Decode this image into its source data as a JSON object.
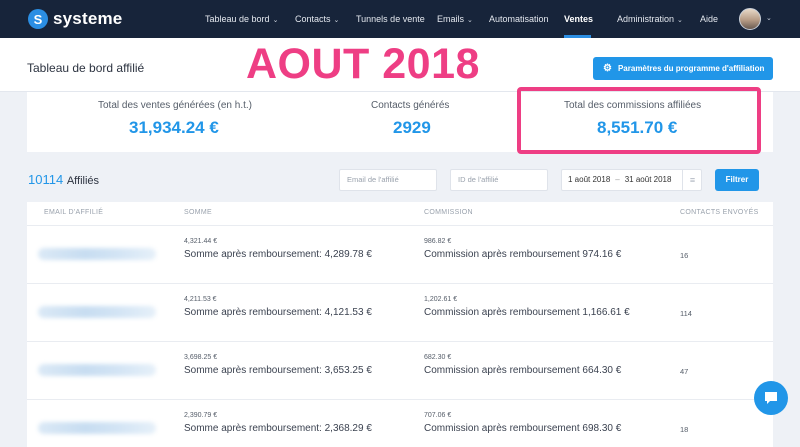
{
  "app": {
    "logo_text": "systeme",
    "logo_glyph": "S"
  },
  "nav": {
    "items": [
      {
        "label": "Tableau de bord",
        "has_dropdown": true
      },
      {
        "label": "Contacts",
        "has_dropdown": true
      },
      {
        "label": "Tunnels de vente",
        "has_dropdown": false
      },
      {
        "label": "Emails",
        "has_dropdown": true
      },
      {
        "label": "Automatisation",
        "has_dropdown": false
      },
      {
        "label": "Ventes",
        "has_dropdown": false,
        "active": true
      },
      {
        "label": "Administration",
        "has_dropdown": true
      },
      {
        "label": "Aide",
        "has_dropdown": false
      }
    ],
    "chevron_glyph": "⌄"
  },
  "header": {
    "title": "Tableau de bord affilié",
    "overlay": "AOUT 2018",
    "settings_button": "Paramètres du programme d'affiliation"
  },
  "stats": [
    {
      "label": "Total des ventes générées (en h.t.)",
      "value": "31,934.24 €"
    },
    {
      "label": "Contacts générés",
      "value": "2929"
    },
    {
      "label": "Total des commissions affiliées",
      "value": "8,551.70 €"
    }
  ],
  "filters": {
    "count": "10114",
    "count_label": "Affiliés",
    "email_placeholder": "Email de l'affilié",
    "id_placeholder": "ID de l'affilié",
    "date_from": "1 août 2018",
    "date_sep": "–",
    "date_to": "31 août 2018",
    "filter_button": "Filtrer"
  },
  "table": {
    "columns": [
      "EMAIL D'AFFILIÉ",
      "SOMME",
      "COMMISSION",
      "CONTACTS ENVOYÉS"
    ],
    "rows": [
      {
        "somme": "4,321.44 €",
        "somme_after": "Somme après remboursement: 4,289.78 €",
        "commission": "986.82 €",
        "commission_after": "Commission après remboursement 974.16 €",
        "contacts": "16"
      },
      {
        "somme": "4,211.53 €",
        "somme_after": "Somme après remboursement: 4,121.53 €",
        "commission": "1,202.61 €",
        "commission_after": "Commission après remboursement 1,166.61 €",
        "contacts": "114"
      },
      {
        "somme": "3,698.25 €",
        "somme_after": "Somme après remboursement: 3,653.25 €",
        "commission": "682.30 €",
        "commission_after": "Commission après remboursement 664.30 €",
        "contacts": "47"
      },
      {
        "somme": "2,390.79 €",
        "somme_after": "Somme après remboursement: 2,368.29 €",
        "commission": "707.06 €",
        "commission_after": "Commission après remboursement 698.30 €",
        "contacts": "18"
      }
    ]
  },
  "colors": {
    "accent": "#2196e8",
    "highlight": "#ee3e84",
    "nav_bg": "#17243a"
  },
  "icons": {
    "settings": "gear-icon",
    "date": "list-icon",
    "chat": "chat-bubble-icon"
  }
}
